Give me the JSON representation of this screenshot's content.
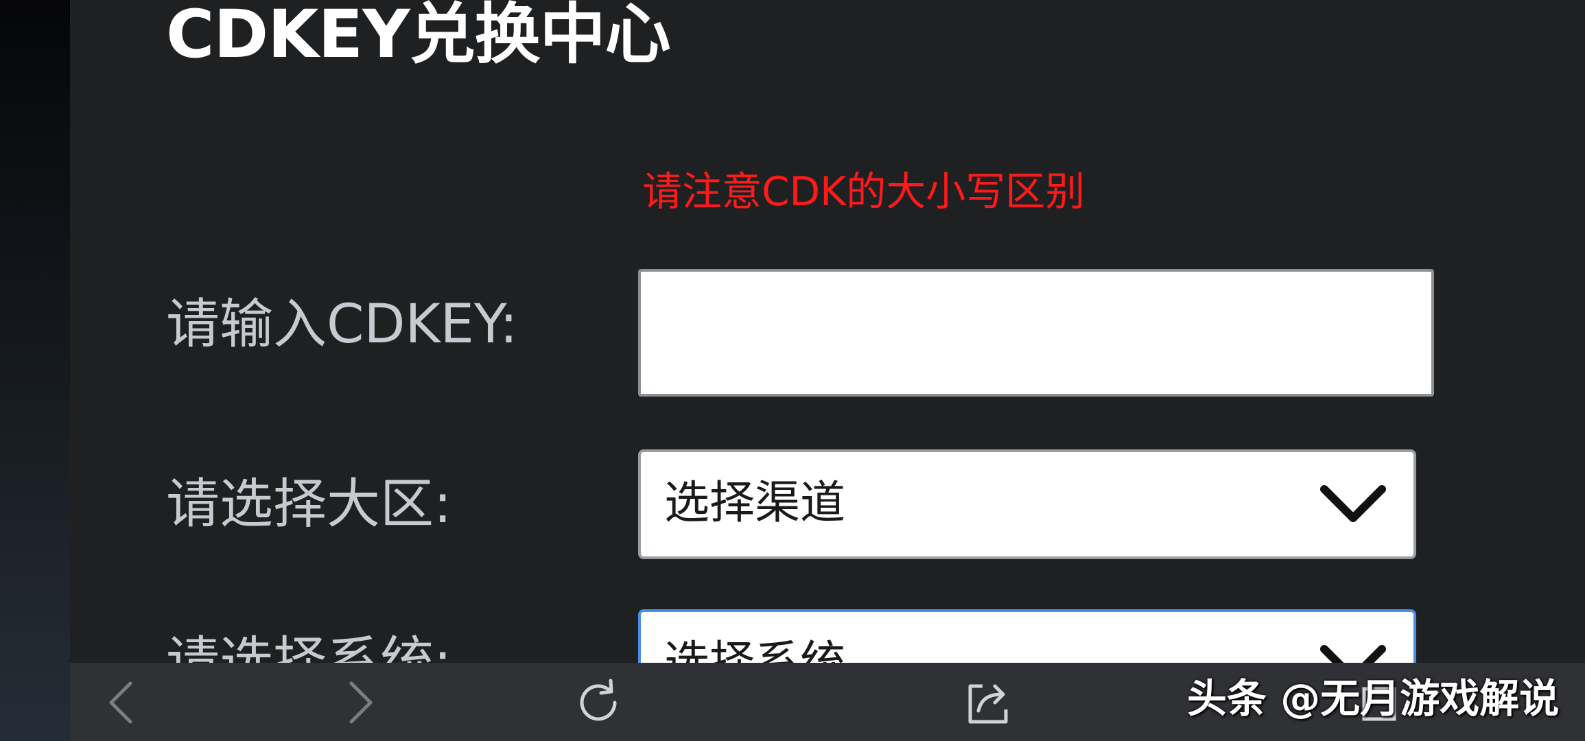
{
  "page": {
    "title": "CDKEY兑换中心",
    "notice": "请注意CDK的大小写区别"
  },
  "form": {
    "cdkey_label": "请输入CDKEY:",
    "cdkey_value": "",
    "region_label": "请选择大区:",
    "region_selected": "选择渠道",
    "system_label": "请选择系统:",
    "system_selected": "选择系统"
  },
  "colors": {
    "notice": "#ff1a1a",
    "focus_border": "#4a8fe7",
    "background": "#1f2022",
    "toolbar": "#303134"
  },
  "toolbar": {
    "icons": [
      "chevron-left-icon",
      "chevron-right-icon",
      "refresh-icon",
      "share-icon",
      "tabs-icon"
    ]
  },
  "watermark": {
    "text": "头条 @无月游戏解说"
  }
}
